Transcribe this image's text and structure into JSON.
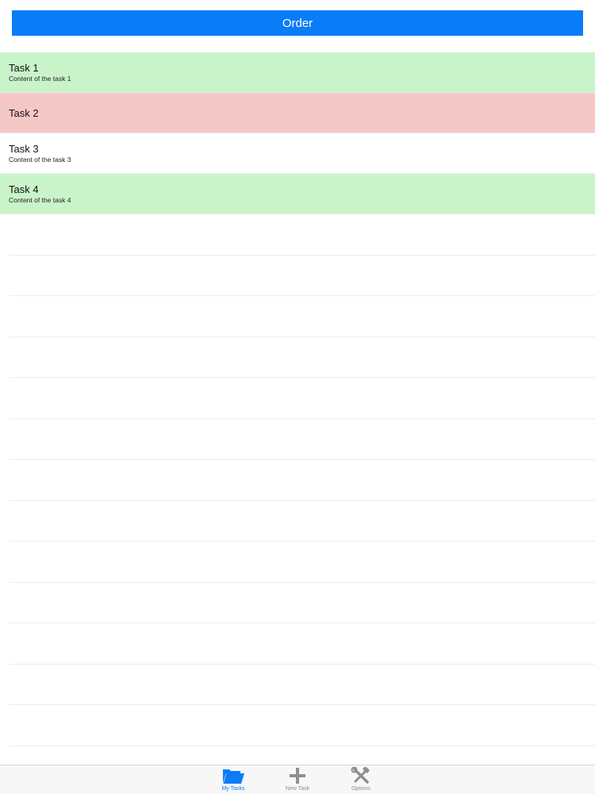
{
  "header": {
    "order_label": "Order"
  },
  "tasks": [
    {
      "title": "Task 1",
      "content": "Content of  the task 1",
      "color": "#c9f4c9"
    },
    {
      "title": "Task 2",
      "content": "",
      "color": "#f5c8c8"
    },
    {
      "title": "Task 3",
      "content": "Content of  the task 3",
      "color": "#ffffff"
    },
    {
      "title": "Task 4",
      "content": "Content of the task 4",
      "color": "#c9f4c9"
    }
  ],
  "tab_bar": {
    "tabs": [
      {
        "label": "My Tasks",
        "icon": "folder-icon",
        "active": true
      },
      {
        "label": "New Task",
        "icon": "plus-icon",
        "active": false
      },
      {
        "label": "Options",
        "icon": "tools-icon",
        "active": false
      }
    ],
    "active_color": "#0a7cf7",
    "inactive_color": "#8e8e93"
  },
  "colors": {
    "accent": "#0a7cf7",
    "task_green": "#c9f4c9",
    "task_red": "#f5c8c8"
  }
}
